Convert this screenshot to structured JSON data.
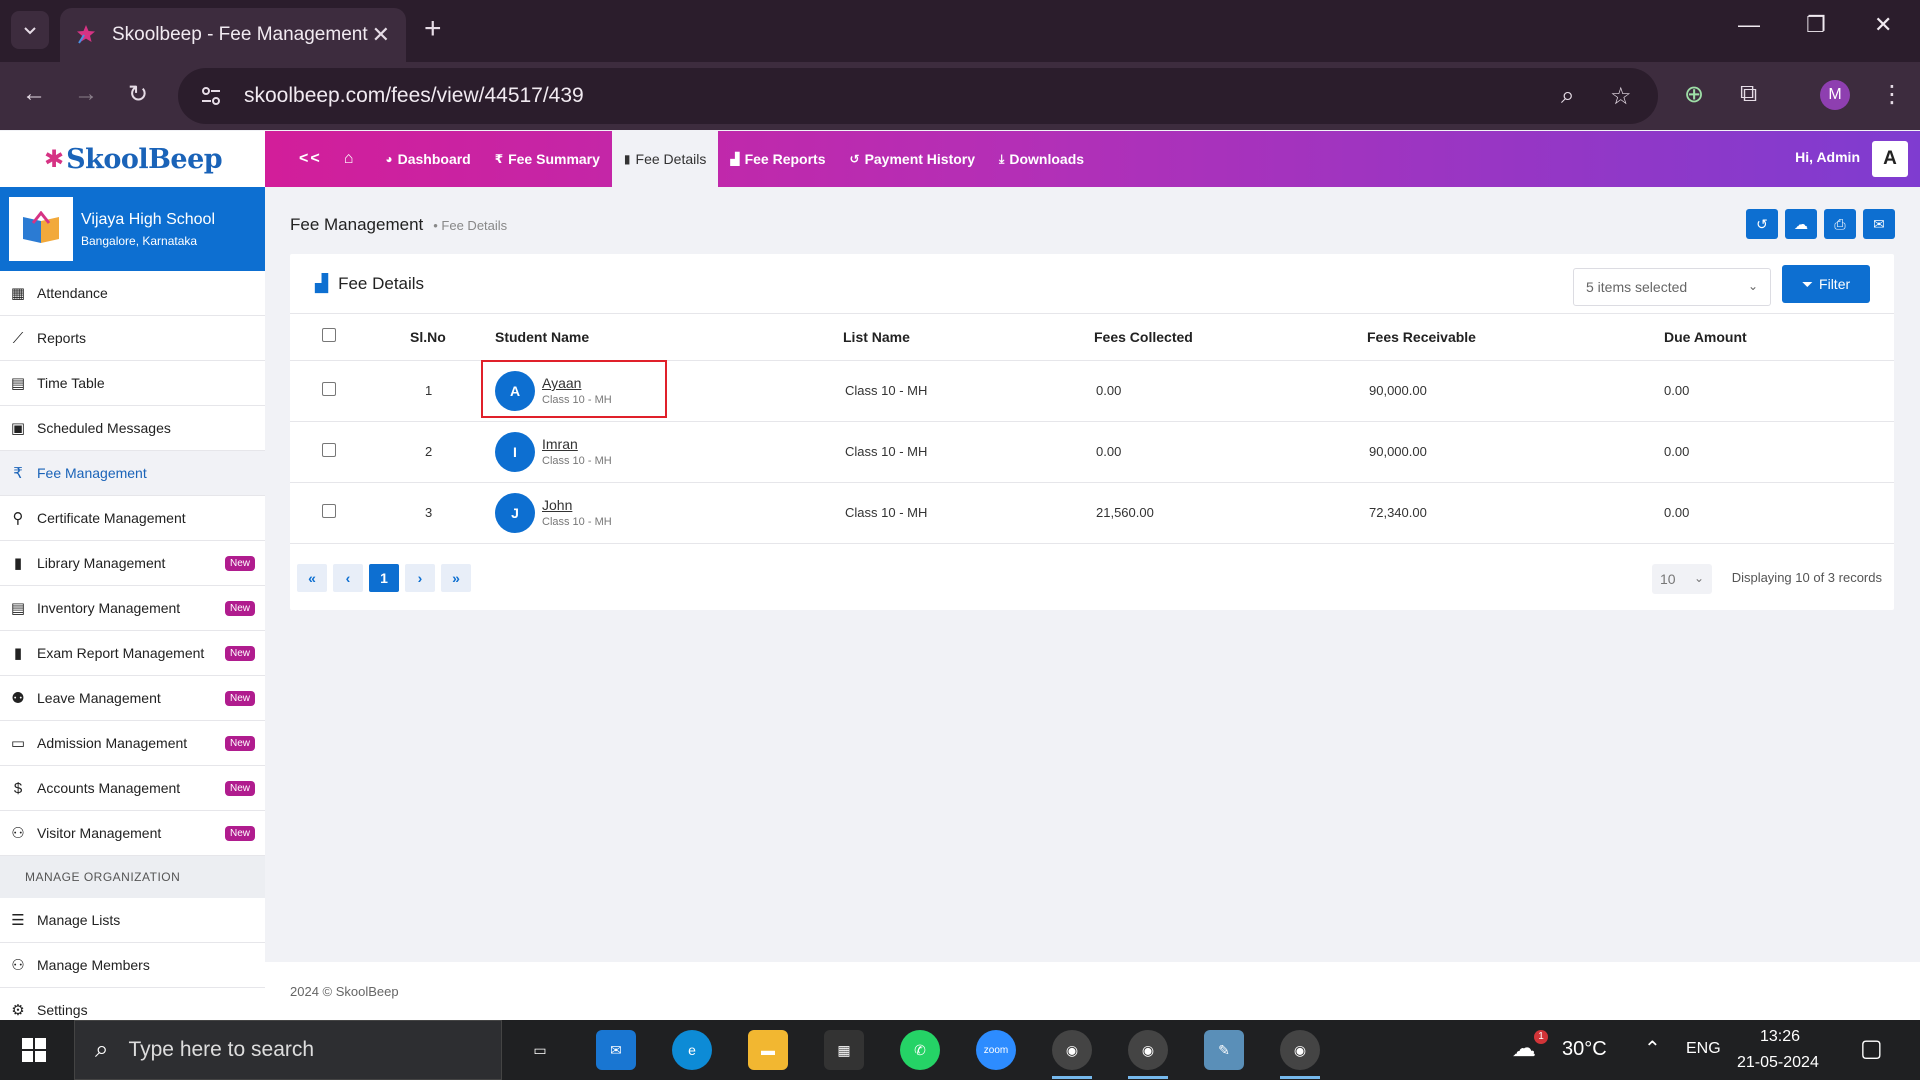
{
  "browser": {
    "tab_title": "Skoolbeep - Fee Management",
    "url": "skoolbeep.com/fees/view/44517/439",
    "profile_initial": "M"
  },
  "app": {
    "logo_text": "SkoolBeep",
    "greeting": "Hi,",
    "user_name": "Admin",
    "user_initial": "A",
    "collapse_label": "<<"
  },
  "topnav": {
    "items": [
      {
        "label": "Dashboard"
      },
      {
        "label": "Fee Summary"
      },
      {
        "label": "Fee Details"
      },
      {
        "label": "Fee Reports"
      },
      {
        "label": "Payment History"
      },
      {
        "label": "Downloads"
      }
    ]
  },
  "school": {
    "name": "Vijaya High School",
    "location": "Bangalore, Karnataka"
  },
  "sidebar": {
    "new_badge": "New",
    "items": [
      {
        "label": "Attendance"
      },
      {
        "label": "Reports"
      },
      {
        "label": "Time Table"
      },
      {
        "label": "Scheduled Messages"
      },
      {
        "label": "Fee Management"
      },
      {
        "label": "Certificate Management"
      },
      {
        "label": "Library Management"
      },
      {
        "label": "Inventory Management"
      },
      {
        "label": "Exam Report Management"
      },
      {
        "label": "Leave Management"
      },
      {
        "label": "Admission Management"
      },
      {
        "label": "Accounts Management"
      },
      {
        "label": "Visitor Management"
      }
    ],
    "section_title": "MANAGE ORGANIZATION",
    "org_items": [
      {
        "label": "Manage Lists"
      },
      {
        "label": "Manage Members"
      },
      {
        "label": "Settings"
      }
    ]
  },
  "breadcrumb": {
    "title": "Fee Management",
    "sub": "Fee Details"
  },
  "card": {
    "title": "Fee Details",
    "select_value": "5 items selected",
    "filter_label": "Filter"
  },
  "table": {
    "headers": {
      "slno": "Sl.No",
      "student": "Student Name",
      "list": "List Name",
      "collected": "Fees Collected",
      "receivable": "Fees Receivable",
      "due": "Due Amount"
    },
    "rows": [
      {
        "slno": "1",
        "initial": "A",
        "name": "Ayaan",
        "class": "Class 10 - MH",
        "list": "Class 10 - MH",
        "collected": "0.00",
        "receivable": "90,000.00",
        "due": "0.00"
      },
      {
        "slno": "2",
        "initial": "I",
        "name": "Imran",
        "class": "Class 10 - MH",
        "list": "Class 10 - MH",
        "collected": "0.00",
        "receivable": "90,000.00",
        "due": "0.00"
      },
      {
        "slno": "3",
        "initial": "J",
        "name": "John",
        "class": "Class 10 - MH",
        "list": "Class 10 - MH",
        "collected": "21,560.00",
        "receivable": "72,340.00",
        "due": "0.00"
      }
    ]
  },
  "pagination": {
    "current_page": "1",
    "per_page": "10",
    "records_text": "Displaying 10 of 3 records"
  },
  "footer": {
    "text": "2024 © SkoolBeep"
  },
  "taskbar": {
    "search_placeholder": "Type here to search",
    "weather_badge": "1",
    "temperature": "30°C",
    "language": "ENG",
    "time": "13:26",
    "date": "21-05-2024",
    "zoom_label": "zoom"
  }
}
